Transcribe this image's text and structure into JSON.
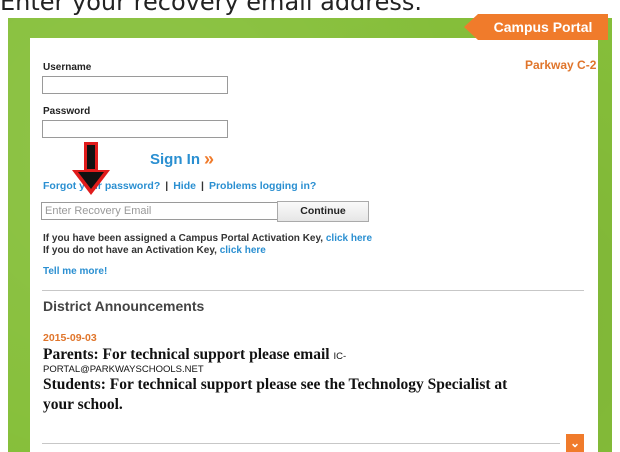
{
  "instruction": "Enter your recovery email address.",
  "header": {
    "portal_tab": "Campus Portal",
    "district": "Parkway C-2"
  },
  "login": {
    "username_label": "Username",
    "password_label": "Password",
    "signin_label": "Sign In",
    "signin_chevron": "»"
  },
  "links": {
    "forgot": "Forgot your password?",
    "hide": "Hide",
    "problems": "Problems logging in?"
  },
  "recovery": {
    "placeholder": "Enter Recovery Email",
    "continue_label": "Continue"
  },
  "activation": {
    "line1_text": "If you have been assigned a Campus Portal Activation Key,",
    "line1_link": "click here",
    "line2_text": "If you do not have an Activation Key,",
    "line2_link": "click here"
  },
  "tell_more": "Tell me more!",
  "announcements": {
    "title": "District Announcements",
    "date": "2015-09-03",
    "line1": "Parents:  For technical support please email",
    "email_part1": "IC-",
    "email_part2": "PORTAL@PARKWAYSCHOOLS.NET",
    "line2": "Students: For technical support please see the Technology Specialist at",
    "line3": "your school."
  },
  "expand_icon": "chevron-down",
  "colors": {
    "accent": "#f07b2b",
    "link": "#2a8fd1",
    "frame": "#86bf3a",
    "arrow": "#e01b1b"
  }
}
